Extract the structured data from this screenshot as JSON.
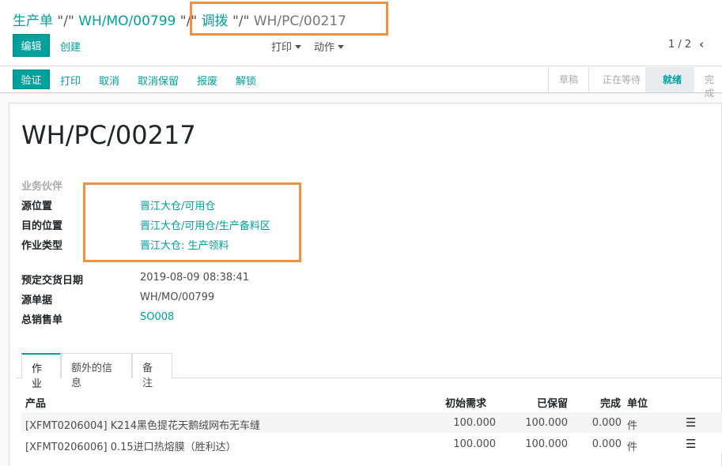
{
  "breadcrumb": {
    "item1": "生产单",
    "sep1": "\"/\"",
    "item2": "WH/MO/00799",
    "sep2": "\"/\"",
    "item3": "调拨",
    "sep3": "\"/\"",
    "current": "WH/PC/00217"
  },
  "toolbar": {
    "edit": "编辑",
    "create": "创建",
    "print": "打印",
    "action": "动作",
    "pager": "1 / 2"
  },
  "actions": {
    "validate": "验证",
    "print": "打印",
    "cancel": "取消",
    "unreserve": "取消保留",
    "scrap": "报废",
    "unlock": "解锁"
  },
  "stages": [
    "草稿",
    "正在等待",
    "就绪",
    "完成"
  ],
  "record": {
    "title": "WH/PC/00217",
    "partner_label": "业务伙伴",
    "source_loc_label": "源位置",
    "source_loc": "晋江大仓/可用仓",
    "dest_loc_label": "目的位置",
    "dest_loc": "晋江大仓/可用仓/生产备料区",
    "op_type_label": "作业类型",
    "op_type": "晋江大仓: 生产领料",
    "sched_label": "预定交货日期",
    "sched": "2019-08-09 08:38:41",
    "origin_label": "源单据",
    "origin": "WH/MO/00799",
    "so_label": "总销售单",
    "so": "SO008"
  },
  "tabs": [
    "作业",
    "额外的信息",
    "备注"
  ],
  "table": {
    "headers": {
      "product": "产品",
      "initial": "初始需求",
      "reserved": "已保留",
      "done": "完成",
      "uom": "单位"
    },
    "rows": [
      {
        "product": "[XFMT0206004] K214黑色提花天鹅绒网布无车缝",
        "initial": "100.000",
        "reserved": "100.000",
        "done": "0.000",
        "uom": "件"
      },
      {
        "product": "[XFMT0206006] 0.15进口热熔膜（胜利达）",
        "initial": "100.000",
        "reserved": "100.000",
        "done": "0.000",
        "uom": "件"
      }
    ]
  },
  "colors": {
    "accent": "#00a09d",
    "highlight": "#f0913f"
  }
}
